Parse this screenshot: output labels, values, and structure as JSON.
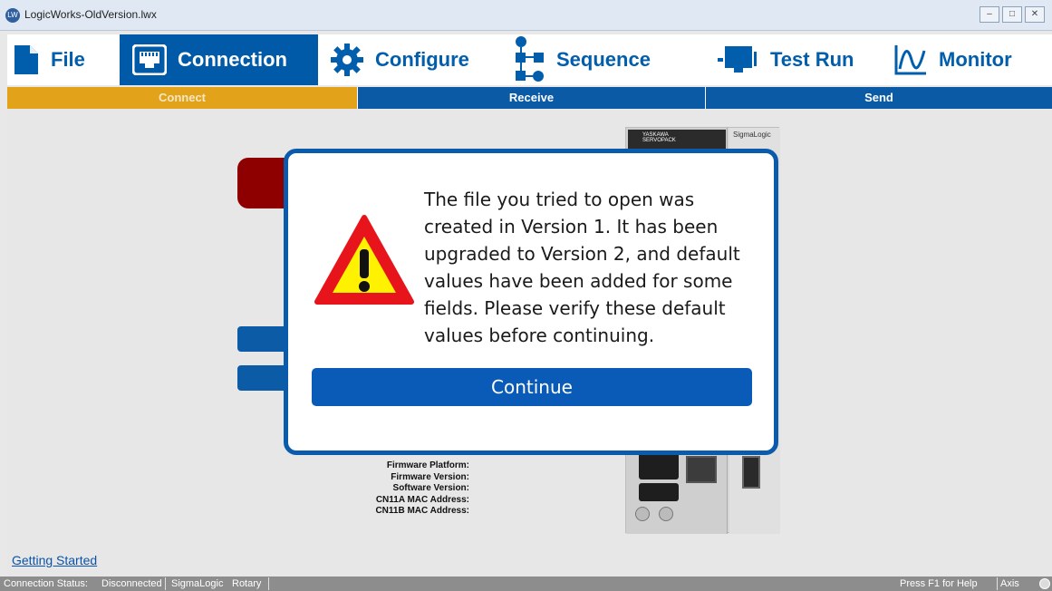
{
  "window": {
    "title": "LogicWorks-OldVersion.lwx",
    "app_icon_text": "LW",
    "minimize": "–",
    "maximize": "□",
    "close": "✕"
  },
  "menu": {
    "file": "File",
    "connection": "Connection",
    "configure": "Configure",
    "sequence": "Sequence",
    "test_run": "Test Run",
    "monitor": "Monitor"
  },
  "subtabs": {
    "connect": "Connect",
    "receive": "Receive",
    "send": "Send"
  },
  "device": {
    "brand": "YASKAWA",
    "brand_sub": "SERVOPACK",
    "sigmalogic_label": "SigmaLogic"
  },
  "info_labels": [
    "Firmware Platform:",
    "Firmware Version:",
    "Software Version:",
    "CN11A MAC Address:",
    "CN11B MAC Address:"
  ],
  "getting_started": "Getting Started",
  "dialog": {
    "message": "The file you tried to open was created in Version 1. It has been upgraded to Version 2, and default values have been added for some fields. Please verify these default values before continuing.",
    "continue_label": "Continue"
  },
  "status": {
    "connection_label": "Connection Status:",
    "connection_value": "Disconnected",
    "device": "SigmaLogic",
    "mode": "Rotary",
    "help": "Press F1 for Help",
    "axis_label": "Axis Status:"
  },
  "colors": {
    "accent_blue": "#005aa8",
    "connect_tab": "#e2a31b",
    "warning_red": "#e8141c",
    "warning_yellow": "#fff200"
  }
}
